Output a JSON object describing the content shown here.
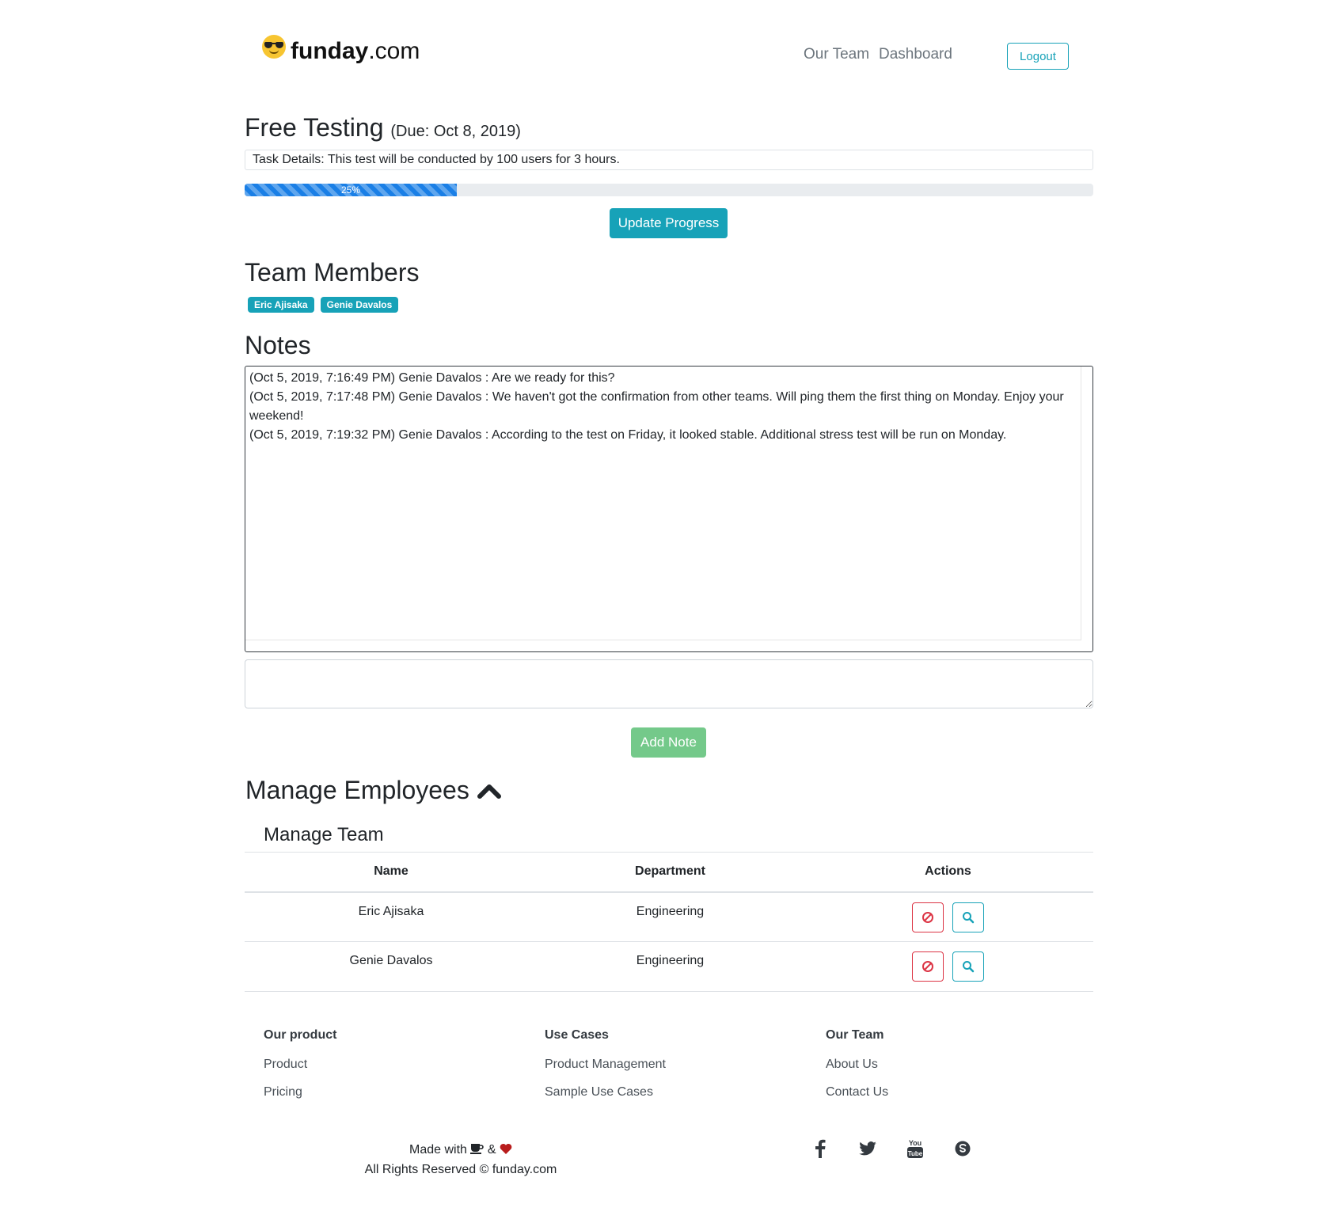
{
  "brand": {
    "name_bold": "funday",
    "name_rest": ".com"
  },
  "nav": {
    "our_team": "Our Team",
    "dashboard": "Dashboard",
    "logout": "Logout"
  },
  "task": {
    "title": "Free Testing",
    "due": "(Due: Oct 8, 2019)",
    "details": "Task Details: This test will be conducted by 100 users for 3 hours.",
    "progress_label": "25%",
    "progress_percent": 25,
    "update_button": "Update Progress"
  },
  "team_members": {
    "heading": "Team Members",
    "members": [
      "Eric Ajisaka",
      "Genie Davalos"
    ]
  },
  "notes": {
    "heading": "Notes",
    "entries": [
      "(Oct 5, 2019, 7:16:49 PM) Genie Davalos : Are we ready for this?",
      "(Oct 5, 2019, 7:17:48 PM) Genie Davalos : We haven't got the confirmation from other teams. Will ping them the first thing on Monday. Enjoy your weekend!",
      "(Oct 5, 2019, 7:19:32 PM) Genie Davalos : According to the test on Friday, it looked stable. Additional stress test will be run on Monday."
    ],
    "input_value": "",
    "add_button": "Add Note"
  },
  "manage": {
    "heading": "Manage Employees",
    "subheading": "Manage Team",
    "columns": [
      "Name",
      "Department",
      "Actions"
    ],
    "rows": [
      {
        "name": "Eric Ajisaka",
        "department": "Engineering"
      },
      {
        "name": "Genie Davalos",
        "department": "Engineering"
      }
    ]
  },
  "footer": {
    "col1": {
      "title": "Our product",
      "links": [
        "Product",
        "Pricing"
      ]
    },
    "col2": {
      "title": "Use Cases",
      "links": [
        "Product Management",
        "Sample Use Cases"
      ]
    },
    "col3": {
      "title": "Our Team",
      "links": [
        "About Us",
        "Contact Us"
      ]
    },
    "made_with": "Made with",
    "amp": "&",
    "rights": "All Rights Reserved © funday.com",
    "social_icons": [
      "facebook-icon",
      "twitter-icon",
      "youtube-icon",
      "skype-icon"
    ]
  },
  "colors": {
    "accent": "#17a2b8",
    "primary": "#1a7fe6",
    "success": "#74c98a",
    "danger": "#dc3545"
  }
}
